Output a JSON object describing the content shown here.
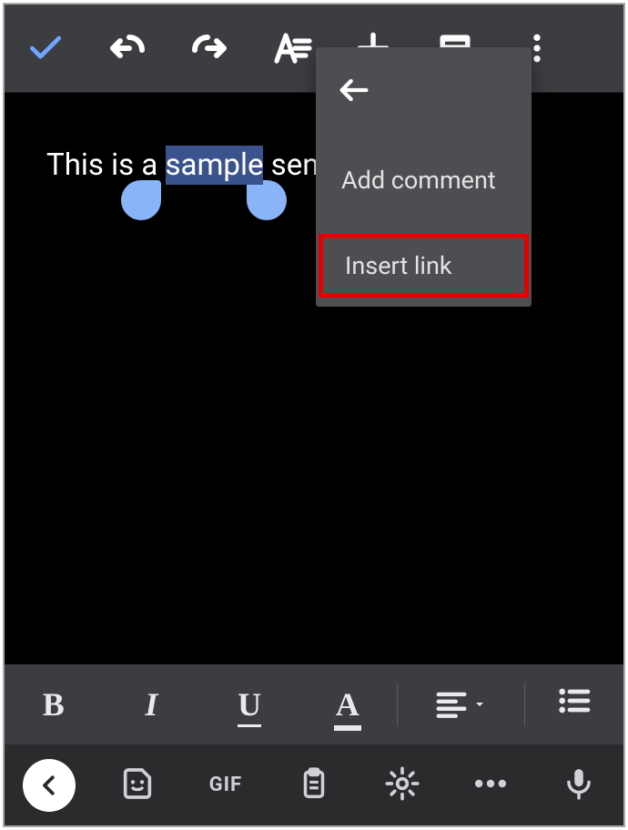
{
  "toolbar": {
    "check": "check-icon",
    "undo": "undo-icon",
    "redo": "redo-icon",
    "text_format": "text-format-icon",
    "plus": "plus-icon",
    "comments": "comments-icon",
    "overflow": "more-vert-icon"
  },
  "document": {
    "text_before": "This is a ",
    "text_selected": "sample",
    "text_after": " sent"
  },
  "dropdown": {
    "back": "back-icon",
    "add_comment": "Add comment",
    "insert_link": "Insert link"
  },
  "format_bar": {
    "bold": "B",
    "italic": "I",
    "underline": "U",
    "text_color": "A",
    "align": "align-left-icon",
    "list": "bullet-list-icon"
  },
  "keyboard_bar": {
    "collapse": "chevron-left-icon",
    "sticker": "sticker-icon",
    "gif": "GIF",
    "clipboard": "clipboard-icon",
    "settings": "gear-icon",
    "more": "more-horiz-icon",
    "mic": "mic-icon"
  },
  "colors": {
    "accent_blue": "#6fa4ff",
    "selection_handle": "#8ab4f8",
    "selection_bg": "#3a538d",
    "highlight_border": "#e60000"
  }
}
